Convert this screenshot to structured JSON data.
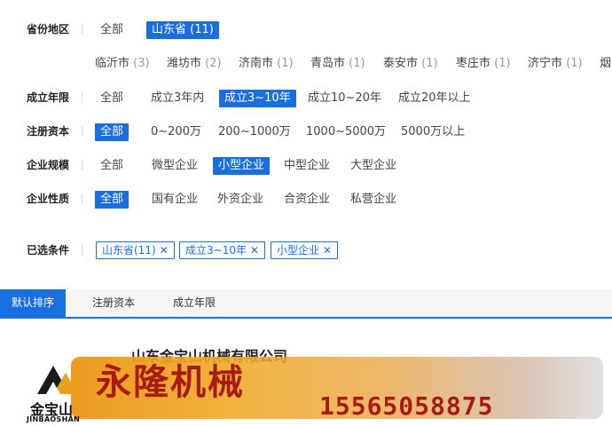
{
  "filters": {
    "province": {
      "label": "省份地区",
      "options": [
        "全部",
        "山东省 (11)"
      ],
      "cities": [
        {
          "name": "临沂市",
          "count": "(3)"
        },
        {
          "name": "潍坊市",
          "count": "(2)"
        },
        {
          "name": "济南市",
          "count": "(1)"
        },
        {
          "name": "青岛市",
          "count": "(1)"
        },
        {
          "name": "泰安市",
          "count": "(1)"
        },
        {
          "name": "枣庄市",
          "count": "(1)"
        },
        {
          "name": "济宁市",
          "count": "(1)"
        },
        {
          "name": "烟",
          "count": ""
        }
      ]
    },
    "years": {
      "label": "成立年限",
      "options": [
        "全部",
        "成立3年内",
        "成立3~10年",
        "成立10~20年",
        "成立20年以上"
      ]
    },
    "capital": {
      "label": "注册资本",
      "options": [
        "全部",
        "0~200万",
        "200~1000万",
        "1000~5000万",
        "5000万以上"
      ]
    },
    "scale": {
      "label": "企业规模",
      "options": [
        "全部",
        "微型企业",
        "小型企业",
        "中型企业",
        "大型企业"
      ]
    },
    "nature": {
      "label": "企业性质",
      "options": [
        "全部",
        "国有企业",
        "外资企业",
        "合资企业",
        "私营企业"
      ]
    }
  },
  "selected": {
    "label": "已选条件",
    "tags": [
      "山东省(11)",
      "成立3~10年",
      "小型企业"
    ],
    "close_glyph": "✕"
  },
  "sort": {
    "items": [
      "默认排序",
      "注册资本",
      "成立年限"
    ]
  },
  "result": {
    "company_name": "山东金宝山机械有限公司",
    "logo_text": "金宝山",
    "logo_sub": "JINBAOSHAN"
  },
  "banner": {
    "title": "永隆机械",
    "phone": "15565058875"
  },
  "colors": {
    "accent": "#1a6fe0",
    "banner_text": "#a81c10"
  }
}
